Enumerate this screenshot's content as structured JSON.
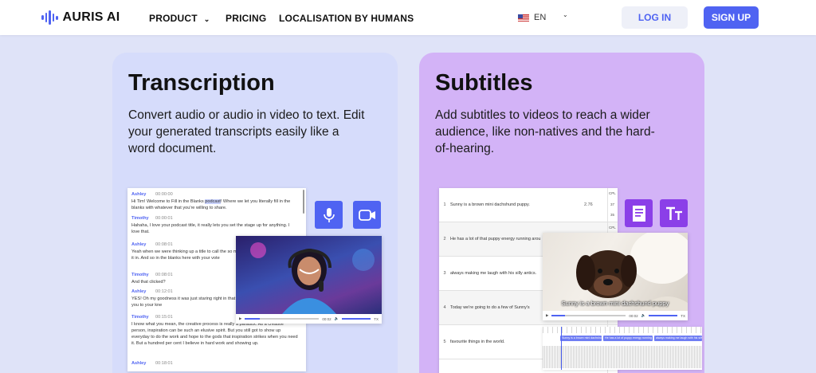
{
  "nav": {
    "brand": "AURIS AI",
    "product": "PRODUCT",
    "pricing": "PRICING",
    "localisation": "LOCALISATION BY HUMANS",
    "language": "EN",
    "login": "LOG IN",
    "signup": "SIGN UP"
  },
  "transcription": {
    "title": "Transcription",
    "description": "Convert audio or audio in video to text. Edit your generated transcripts easily like a word document.",
    "entries": [
      {
        "speaker": "Ashley",
        "time": "00:00:00",
        "text_before": "Hi Tim! Welcome to Fill in the Blanks ",
        "highlight": "podcast",
        "text_after": "! Where we let you literally fill in the blanks with whatever that you're willing to share."
      },
      {
        "speaker": "Timothy",
        "time": "00:00:01",
        "text": "Hahaha, I love your podcast title, it really lets you set the stage up for anything. I love that."
      },
      {
        "speaker": "Ashley",
        "time": "00:08:01",
        "text": "Yeah when we were thinking up a title to call the so many choices but we had to vote it in. And so in the blanks here with your vote"
      },
      {
        "speaker": "Timothy",
        "time": "00:08:01",
        "text": "And that clicked?"
      },
      {
        "speaker": "Ashley",
        "time": "00:12:01",
        "text": "YES! Oh my goodness it was just staring right in that creative process that brings you to your kne"
      },
      {
        "speaker": "Timothy",
        "time": "00:15:01",
        "text": "I know what you mean, the creative process is really a paradox. As a creative person, inspiration can be such an elusive spirit. But you still got to show up everyday to do the work and hope to the gods that inspiration strikes when you need it. But a hundred per cent I believe in hard work and showing up."
      },
      {
        "speaker": "Ashley",
        "time": "00:18:01",
        "text": ""
      }
    ],
    "video_time": "00:02",
    "video_tx": "TX"
  },
  "subtitles": {
    "title": "Subtitles",
    "description": "Add subtitles to videos to reach a wider audience, like non-natives and the hard-of-hearing.",
    "cps_label": "CPL",
    "rows": [
      {
        "num": "1",
        "text": "Sunny is a brown mini dachshund puppy.",
        "cps": "2.76",
        "cpl": "37"
      },
      {
        "num": "2",
        "text": "He has a lot of that puppy energy running arou",
        "cps": "",
        "cpl": ""
      },
      {
        "num": "3",
        "text": "always making me laugh with his silly antics.",
        "cps": "",
        "cpl": ""
      },
      {
        "num": "4",
        "text": "Today we're going to do a few of Sunny's",
        "cps": "",
        "cpl": ""
      },
      {
        "num": "5",
        "text": "favourite things in the world.",
        "cps": "",
        "cpl": ""
      }
    ],
    "col_values": [
      "CPL",
      "37",
      "35",
      "CPL"
    ],
    "caption": "Sunny is a brown mini dachshund puppy",
    "video_time": "00:02",
    "video_tx": "TX",
    "timeline_clips": [
      "Sunny is a brown mini dachshund puppy.",
      "He has a lot of puppy energy running around the house",
      "always making me laugh with his silly antics."
    ]
  },
  "colors": {
    "accent": "#4f63f2",
    "transcription_bg": "#d6dcfb",
    "subtitles_bg": "#d3b3f7",
    "page_bg": "#dfe3f8"
  }
}
